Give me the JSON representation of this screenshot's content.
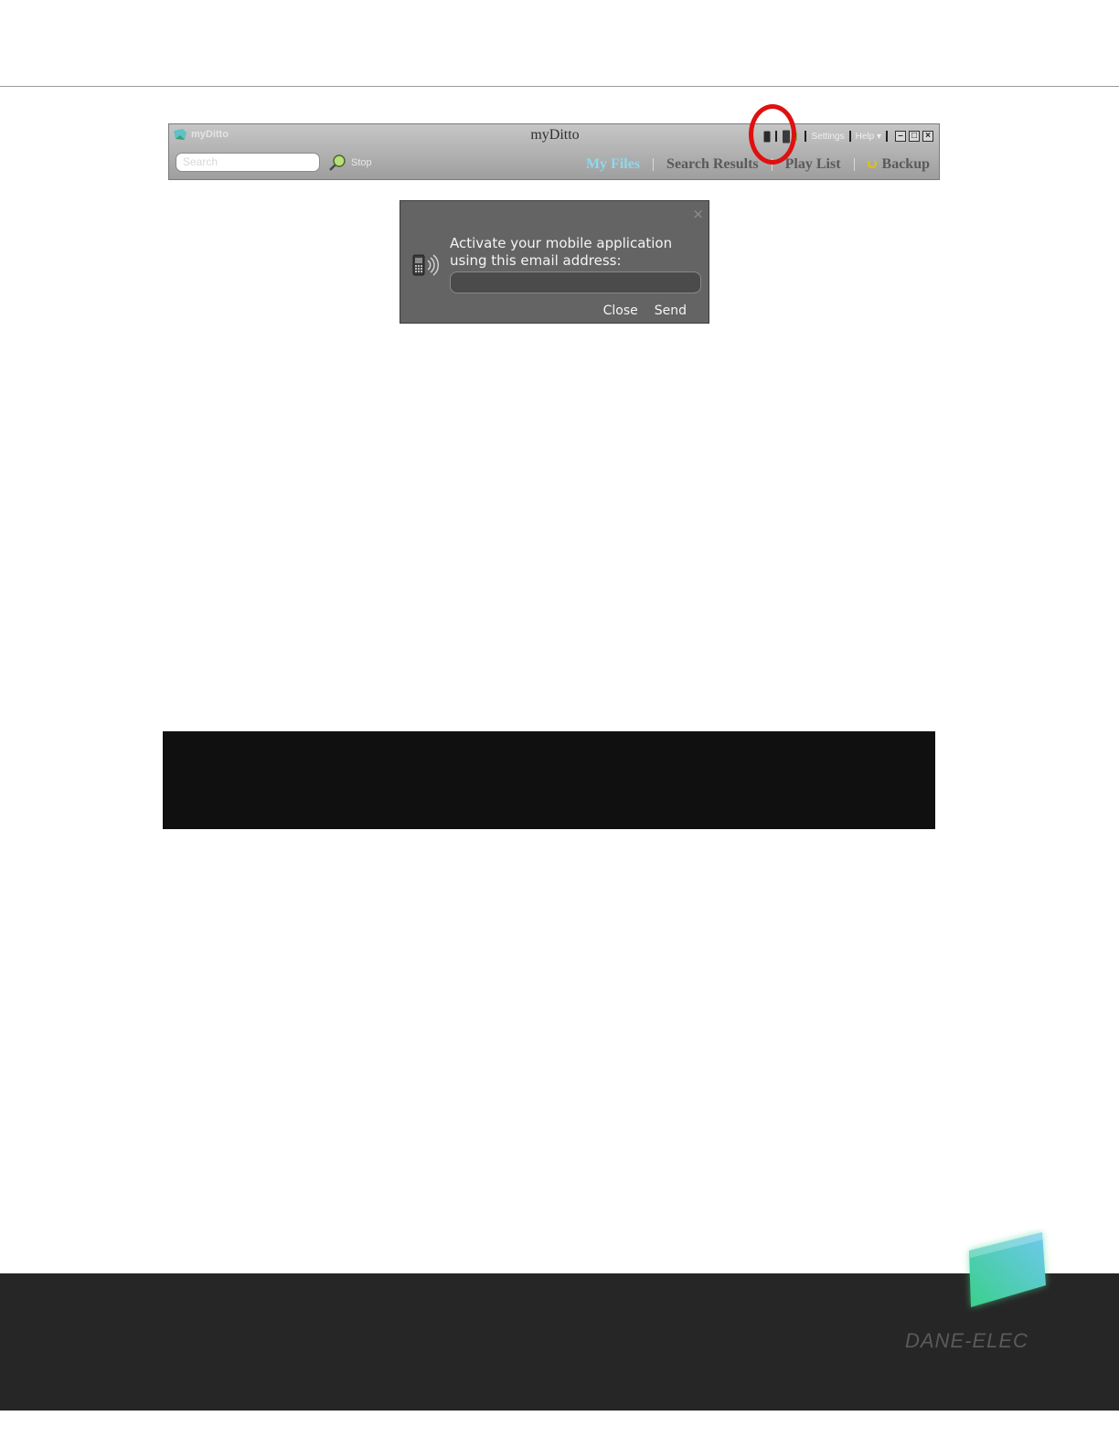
{
  "app": {
    "brand": "myDitto",
    "title": "myDitto",
    "search_placeholder": "Search",
    "stop_label": "Stop",
    "settings_label": "Settings",
    "help_label": "Help"
  },
  "nav": {
    "tabs": [
      {
        "label": "My Files"
      },
      {
        "label": "Search Results"
      },
      {
        "label": "Play List"
      },
      {
        "label": "Backup"
      }
    ]
  },
  "popup": {
    "close_x": "×",
    "message": "Activate your mobile application using this email address:",
    "email_value": "",
    "close_label": "Close",
    "send_label": "Send"
  },
  "footer": {
    "logo_text": "DANE-ELEC"
  },
  "colors": {
    "highlight": "#e01010",
    "active_tab": "#8fd8f0",
    "footer_bg": "#262626"
  }
}
